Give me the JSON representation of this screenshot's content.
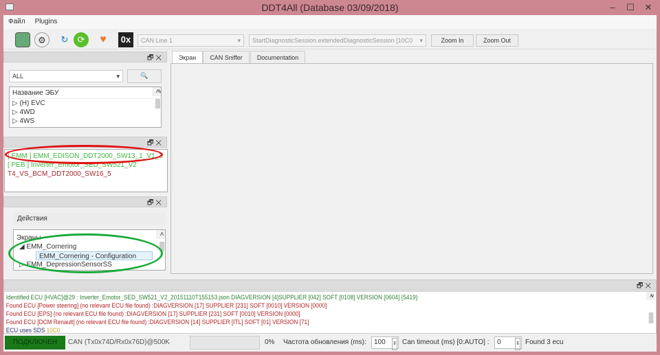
{
  "window": {
    "title": "DDT4All (Database 03/09/2018)",
    "minimize": "–",
    "maximize": "☐",
    "close": "✕"
  },
  "menu": [
    "Файл",
    "Plugins"
  ],
  "toolbar": {
    "can_line": "CAN Line 1",
    "session": "StartDiagnosticSession.extendedDiagnosticSession [10C0",
    "zoom_in": "Zoom In",
    "zoom_out": "Zoom Out",
    "hex_label": "0x"
  },
  "ecu_dock": {
    "filter": "ALL",
    "header": "Название ЭБУ",
    "items": [
      "(H) EVC",
      "4WD",
      "4WS"
    ]
  },
  "found_dock": {
    "items": [
      {
        "text": "[ EMM ] EMM_EDISON_DDT2000_SW13_1_V1_3",
        "color": "#3fb83f"
      },
      {
        "text": "[ PEB ] Inverter_Emotor_SED_SW521_V2",
        "color": "#3fb83f"
      },
      {
        "text": "T4_VS_BCM_DDT2000_SW16_5",
        "color": "#a0262a"
      }
    ]
  },
  "screens_dock": {
    "actions": "Действия",
    "header": "Экраны",
    "group": "EMM_Cornering",
    "selected": "EMM_Cornering - Configuration",
    "next": "EMM_DepressionSensorSS"
  },
  "tabs": [
    "Экран",
    "CAN Sniffer",
    "Documentation"
  ],
  "log": [
    {
      "text": "Identified ECU [HVAC]@29 : Inverter_Emotor_SED_SW521_V2_20151110T155153.json DIAGVERSION [4]SUPPLIER [042] SOFT [0108] VERSION [0604] {5419}",
      "color": "#2e7d32"
    },
    {
      "text": "Found ECU [Power steering] (no relevant ECU file found) :DIAGVERSION [17] SUPPLIER [231] SOFT [0010] VERSION [0000]",
      "color": "#b22222"
    },
    {
      "text": "Found ECU [EPS] (no relevant ECU file found) :DIAGVERSION [17] SUPPLIER [231] SOFT [0010] VERSION [0000]",
      "color": "#b22222"
    },
    {
      "text": "Found ECU [DCM Renault] (no relevant ECU file found) :DIAGVERSION [14] SUPPLIER [ITL] SOFT [01] VERSION [71]",
      "color": "#b22222"
    }
  ],
  "log_sds": {
    "text": "ECU uses SDS",
    "code": "10C0"
  },
  "status": {
    "connected": "ПОДКЛЮЧЕН",
    "can": "CAN (Tx0x74D/Rx0x76D)@500K",
    "progress": "0%",
    "progress_value": 0,
    "refresh_label": "Частота обновления (ms):",
    "refresh_value": "100",
    "timeout_label": "Can timeout (ms) [0:AUTO] :",
    "timeout_value": "0",
    "found": "Found 3 ecu"
  },
  "colors": {
    "accent_connected": "#1a7a1a",
    "annotation_red": "#e01010",
    "annotation_green": "#1aaa3a",
    "frame": "#cd8791"
  }
}
